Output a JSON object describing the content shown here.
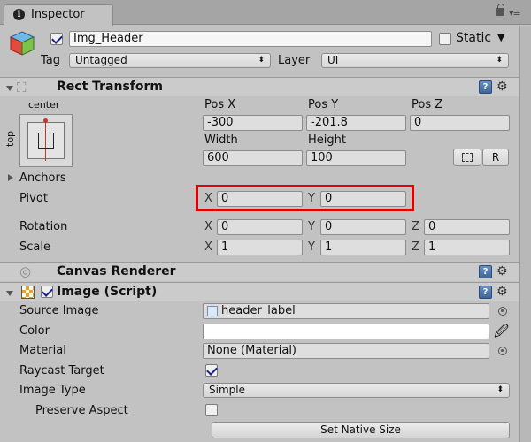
{
  "window": {
    "tab_title": "Inspector"
  },
  "gameobject": {
    "name": "Img_Header",
    "static_label": "Static",
    "tag_label": "Tag",
    "tag_value": "Untagged",
    "layer_label": "Layer",
    "layer_value": "UI"
  },
  "rect_transform": {
    "title": "Rect Transform",
    "anchor_top": "center",
    "anchor_side": "top",
    "pos_x_label": "Pos X",
    "pos_y_label": "Pos Y",
    "pos_z_label": "Pos Z",
    "pos_x": "-300",
    "pos_y": "-201.8",
    "pos_z": "0",
    "width_label": "Width",
    "height_label": "Height",
    "width": "600",
    "height": "100",
    "r_button": "R",
    "anchors_label": "Anchors",
    "pivot_label": "Pivot",
    "pivot_x": "0",
    "pivot_y": "0",
    "rotation_label": "Rotation",
    "rotation_x": "0",
    "rotation_y": "0",
    "rotation_z": "0",
    "scale_label": "Scale",
    "scale_x": "1",
    "scale_y": "1",
    "scale_z": "1",
    "axis_x": "X",
    "axis_y": "Y",
    "axis_z": "Z"
  },
  "canvas_renderer": {
    "title": "Canvas Renderer"
  },
  "image_script": {
    "title": "Image (Script)",
    "source_image_label": "Source Image",
    "source_image_value": "header_label",
    "color_label": "Color",
    "material_label": "Material",
    "material_value": "None (Material)",
    "raycast_label": "Raycast Target",
    "image_type_label": "Image Type",
    "image_type_value": "Simple",
    "preserve_aspect_label": "Preserve Aspect",
    "set_native_size": "Set Native Size"
  },
  "colors": {
    "highlight": "#e00000",
    "panel_bg": "#c2c2c2"
  }
}
